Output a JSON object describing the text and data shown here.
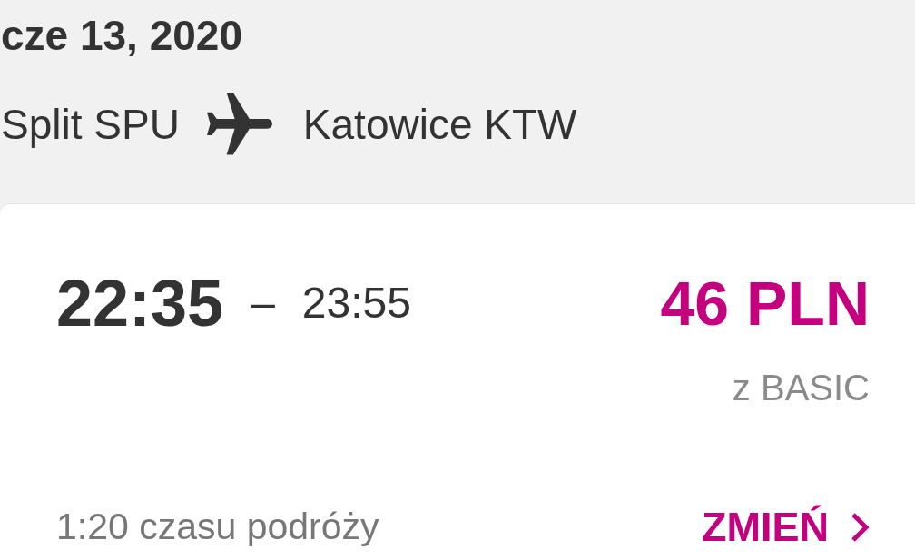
{
  "header": {
    "date": "cze 13, 2020",
    "origin": "Split SPU",
    "destination": "Katowice KTW"
  },
  "flight": {
    "departure_time": "22:35",
    "separator": "–",
    "arrival_time": "23:55",
    "price": "46 PLN",
    "fare": "z BASIC",
    "duration": "1:20 czasu podróży",
    "change_button": "ZMIEŃ"
  }
}
